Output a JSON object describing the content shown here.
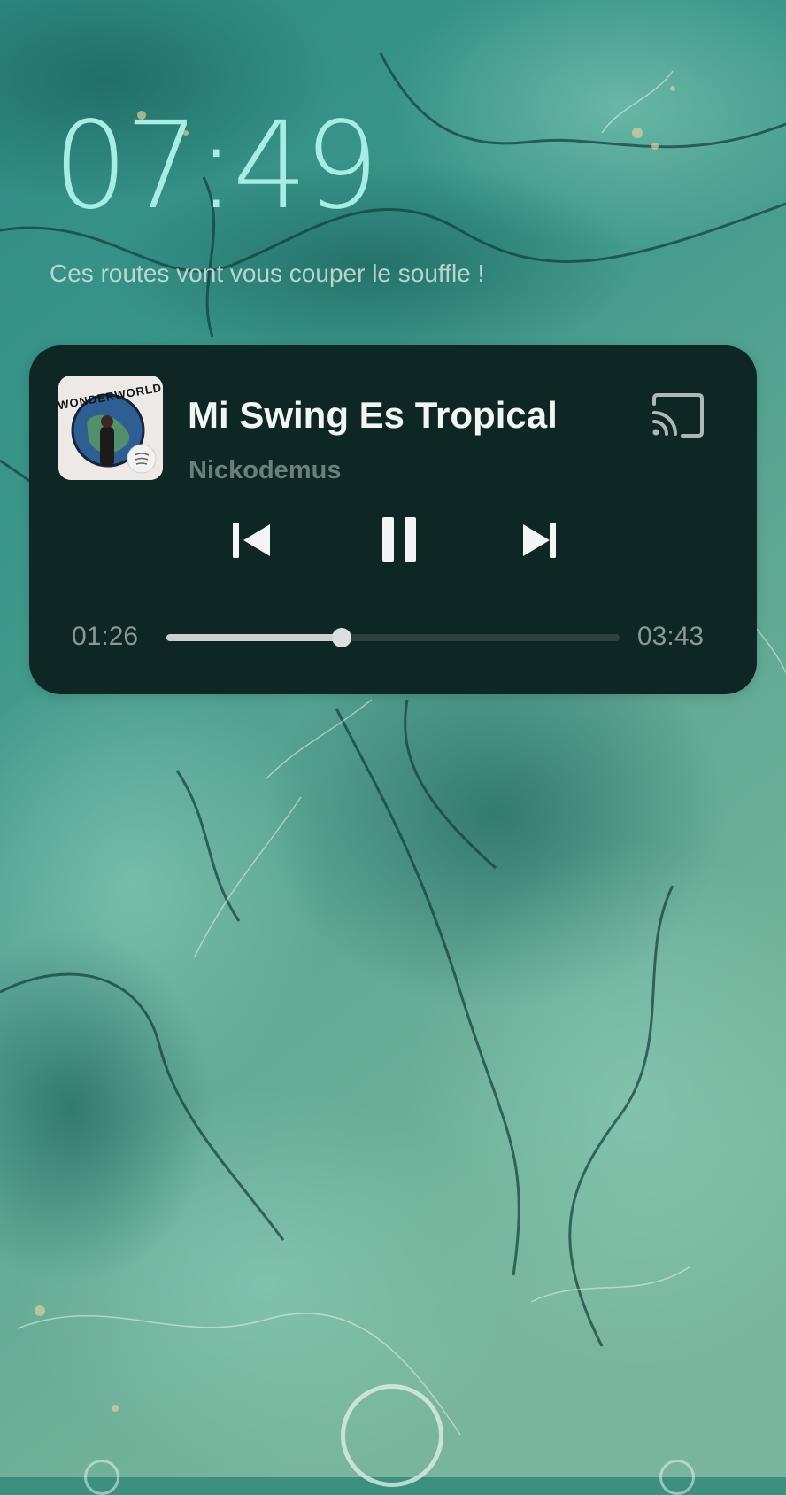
{
  "lockscreen": {
    "time": "07:49",
    "slogan": "Ces routes vont vous couper le souffle !"
  },
  "media_player": {
    "album_art_text": "WONDERWORLD",
    "title": "Mi Swing Es Tropical",
    "artist": "Nickodemus",
    "elapsed": "01:26",
    "duration": "03:43",
    "progress_fraction": 0.386
  },
  "icons": {
    "cast": "cast-icon",
    "previous": "skip-previous-icon",
    "pause": "pause-icon",
    "next": "skip-next-icon",
    "unlock": "unlock-ring-icon"
  },
  "colors": {
    "player_bg": "#0e2725",
    "clock": "#a7ede4",
    "seek_fill": "#c9d2d0",
    "seek_track": "#2c403e"
  }
}
